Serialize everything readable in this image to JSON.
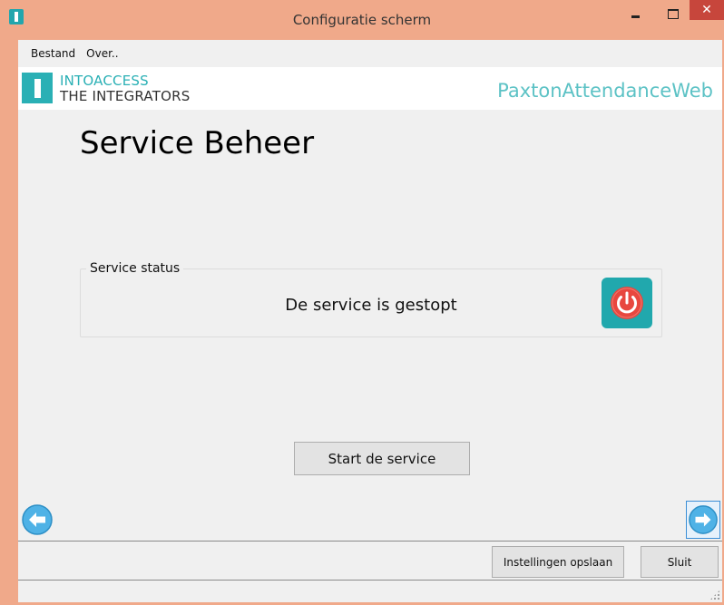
{
  "window": {
    "title": "Configuratie scherm",
    "close_glyph": "✕"
  },
  "menu": {
    "items": [
      {
        "label": "Bestand"
      },
      {
        "label": "Over.."
      }
    ]
  },
  "brand": {
    "name_line1": "INTOACCESS",
    "name_line2": "THE INTEGRATORS",
    "product": "PaxtonAttendanceWeb",
    "accent_color": "#2ab0b5"
  },
  "main": {
    "title": "Service Beheer",
    "status_group": {
      "label": "Service status",
      "status_text": "De service is gestopt",
      "status_icon": "power-off-icon",
      "status_color": "#e8473f"
    },
    "start_button_label": "Start de service"
  },
  "navigation": {
    "back_icon": "arrow-left-icon",
    "next_icon": "arrow-right-icon"
  },
  "footer": {
    "save_label": "Instellingen opslaan",
    "close_label": "Sluit"
  }
}
